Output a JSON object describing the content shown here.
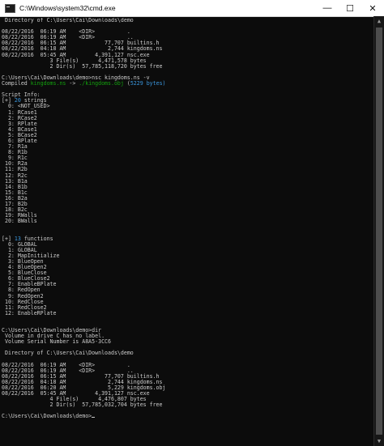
{
  "window": {
    "title": "C:\\Windows\\system32\\cmd.exe",
    "buttons": {
      "minimize": "—",
      "maximize": "☐",
      "close": "✕"
    }
  },
  "colors": {
    "background": "#0c0c0c",
    "text": "#cccccc",
    "green": "#13a10e",
    "cyan": "#3a96dd"
  },
  "console": {
    "lines": [
      [
        {
          "t": " Directory of C:\\Users\\Cai\\Downloads\\demo"
        }
      ],
      [
        {
          "t": ""
        }
      ],
      [
        {
          "t": "08/22/2016  06:19 AM    <DIR>          ."
        }
      ],
      [
        {
          "t": "08/22/2016  06:19 AM    <DIR>          .."
        }
      ],
      [
        {
          "t": "08/22/2016  06:15 AM            77,707 builtins.h"
        }
      ],
      [
        {
          "t": "08/22/2016  04:18 AM             2,744 kingdoms.ns"
        }
      ],
      [
        {
          "t": "08/22/2016  05:45 AM         4,391,127 nsc.exe"
        }
      ],
      [
        {
          "t": "               3 File(s)      4,471,578 bytes"
        }
      ],
      [
        {
          "t": "               2 Dir(s)  57,785,118,720 bytes free"
        }
      ],
      [
        {
          "t": ""
        }
      ],
      [
        {
          "t": "C:\\Users\\Cai\\Downloads\\demo>nsc kingdoms.ns -v"
        }
      ],
      [
        {
          "t": "Compiled "
        },
        {
          "t": "kingdoms.ns",
          "c": "green"
        },
        {
          "t": " -> ",
          "c": "gray"
        },
        {
          "t": "./kingdoms.obj",
          "c": "green"
        },
        {
          "t": " ("
        },
        {
          "t": "5229",
          "c": "cyan"
        },
        {
          "t": " bytes)",
          "c": "cyan"
        }
      ],
      [
        {
          "t": ""
        }
      ],
      [
        {
          "t": "Script Info:"
        }
      ],
      [
        {
          "t": "[+] "
        },
        {
          "t": "20",
          "c": "cyan"
        },
        {
          "t": " strings"
        }
      ],
      [
        {
          "t": "  0: <NOT_USED>"
        }
      ],
      [
        {
          "t": "  1: RCase1"
        }
      ],
      [
        {
          "t": "  2: RCase2"
        }
      ],
      [
        {
          "t": "  3: RPlate"
        }
      ],
      [
        {
          "t": "  4: BCase1"
        }
      ],
      [
        {
          "t": "  5: BCase2"
        }
      ],
      [
        {
          "t": "  6: BPlate"
        }
      ],
      [
        {
          "t": "  7: R1a"
        }
      ],
      [
        {
          "t": "  8: R1b"
        }
      ],
      [
        {
          "t": "  9: R1c"
        }
      ],
      [
        {
          "t": " 10: R2a"
        }
      ],
      [
        {
          "t": " 11: R2b"
        }
      ],
      [
        {
          "t": " 12: R2c"
        }
      ],
      [
        {
          "t": " 13: B1a"
        }
      ],
      [
        {
          "t": " 14: B1b"
        }
      ],
      [
        {
          "t": " 15: B1c"
        }
      ],
      [
        {
          "t": " 16: B2a"
        }
      ],
      [
        {
          "t": " 17: B2b"
        }
      ],
      [
        {
          "t": " 18: B2c"
        }
      ],
      [
        {
          "t": " 19: RWalls"
        }
      ],
      [
        {
          "t": " 20: BWalls"
        }
      ],
      [
        {
          "t": ""
        }
      ],
      [
        {
          "t": ""
        }
      ],
      [
        {
          "t": "[+] "
        },
        {
          "t": "13",
          "c": "cyan"
        },
        {
          "t": " functions"
        }
      ],
      [
        {
          "t": "  0: GLOBAL"
        }
      ],
      [
        {
          "t": "  1: GLOBAL"
        }
      ],
      [
        {
          "t": "  2: MapInitialize"
        }
      ],
      [
        {
          "t": "  3: BlueOpen"
        }
      ],
      [
        {
          "t": "  4: BlueOpen2"
        }
      ],
      [
        {
          "t": "  5: BlueClose"
        }
      ],
      [
        {
          "t": "  6: BlueClose2"
        }
      ],
      [
        {
          "t": "  7: EnableBPlate"
        }
      ],
      [
        {
          "t": "  8: RedOpen"
        }
      ],
      [
        {
          "t": "  9: RedOpen2"
        }
      ],
      [
        {
          "t": " 10: RedClose"
        }
      ],
      [
        {
          "t": " 11: RedClose2"
        }
      ],
      [
        {
          "t": " 12: EnableRPlate"
        }
      ],
      [
        {
          "t": ""
        }
      ],
      [
        {
          "t": ""
        }
      ],
      [
        {
          "t": "C:\\Users\\Cai\\Downloads\\demo>dir"
        }
      ],
      [
        {
          "t": " Volume in drive C has no label."
        }
      ],
      [
        {
          "t": " Volume Serial Number is A8A5-3CC6"
        }
      ],
      [
        {
          "t": ""
        }
      ],
      [
        {
          "t": " Directory of C:\\Users\\Cai\\Downloads\\demo"
        }
      ],
      [
        {
          "t": ""
        }
      ],
      [
        {
          "t": "08/22/2016  06:19 AM    <DIR>          ."
        }
      ],
      [
        {
          "t": "08/22/2016  06:19 AM    <DIR>          .."
        }
      ],
      [
        {
          "t": "08/22/2016  06:15 AM            77,707 builtins.h"
        }
      ],
      [
        {
          "t": "08/22/2016  04:18 AM             2,744 kingdoms.ns"
        }
      ],
      [
        {
          "t": "08/22/2016  06:20 AM             5,229 kingdoms.obj"
        }
      ],
      [
        {
          "t": "08/22/2016  05:45 AM         4,391,127 nsc.exe"
        }
      ],
      [
        {
          "t": "               4 File(s)      4,476,807 bytes"
        }
      ],
      [
        {
          "t": "               2 Dir(s)  57,785,032,704 bytes free"
        }
      ],
      [
        {
          "t": ""
        }
      ],
      [
        {
          "t": "C:\\Users\\Cai\\Downloads\\demo>"
        }
      ]
    ]
  }
}
